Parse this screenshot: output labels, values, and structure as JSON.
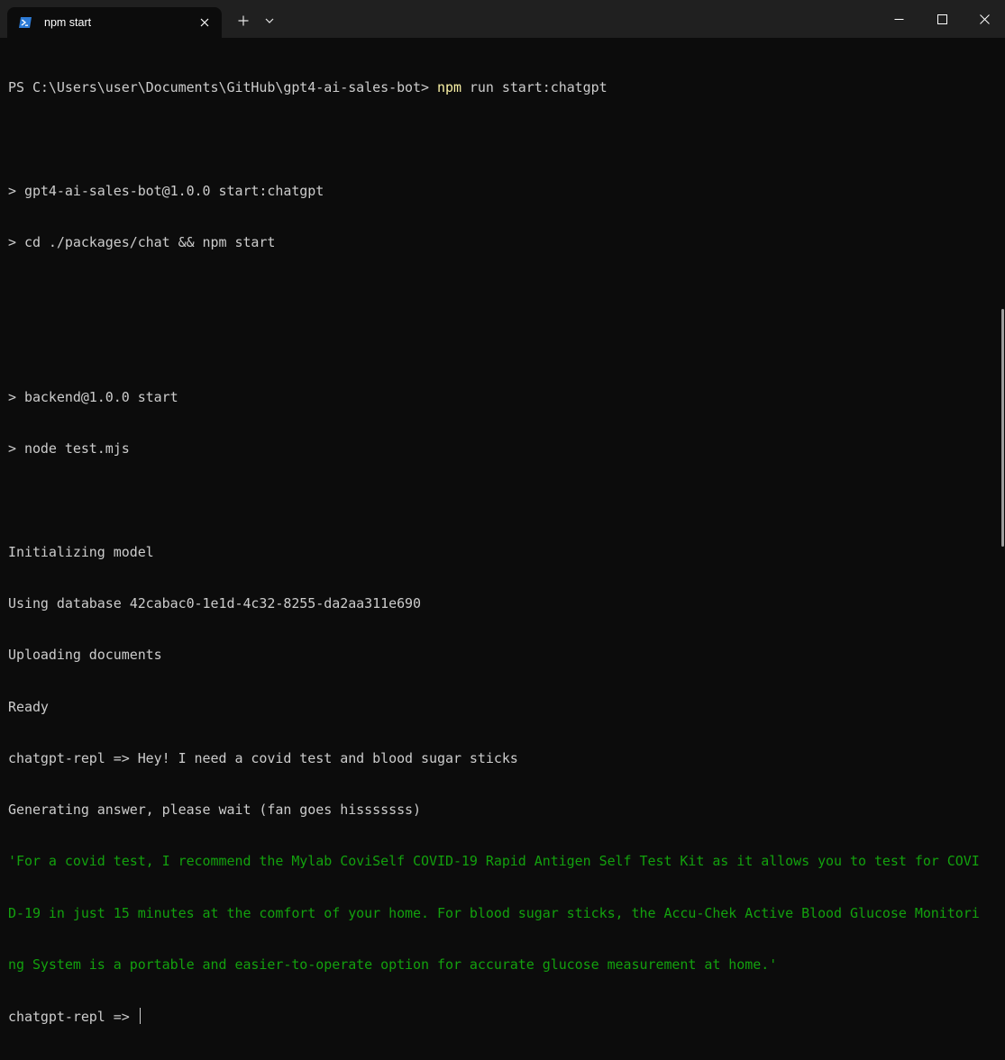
{
  "tab": {
    "title": "npm start",
    "icon": "powershell-icon"
  },
  "window_controls": {
    "minimize": "minimize-icon",
    "maximize": "maximize-icon",
    "close": "close-icon"
  },
  "colors": {
    "background": "#0c0c0c",
    "titlebar": "#202020",
    "text": "#cccccc",
    "command_highlight": "#f9f1a5",
    "answer": "#13a10e"
  },
  "terminal": {
    "prompt": "PS C:\\Users\\user\\Documents\\GitHub\\gpt4-ai-sales-bot> ",
    "command_exe": "npm",
    "command_args": " run start:chatgpt",
    "lines_a": [
      "",
      "> gpt4-ai-sales-bot@1.0.0 start:chatgpt",
      "> cd ./packages/chat && npm start",
      "",
      "",
      "> backend@1.0.0 start",
      "> node test.mjs",
      "",
      "Initializing model",
      "Using database 42cabac0-1e1d-4c32-8255-da2aa311e690",
      "Uploading documents",
      "Ready",
      "chatgpt-repl => Hey! I need a covid test and blood sugar sticks",
      "Generating answer, please wait (fan goes hisssssss)"
    ],
    "answer_lines": [
      "'For a covid test, I recommend the Mylab CoviSelf COVID-19 Rapid Antigen Self Test Kit as it allows you to test for COVI",
      "D-19 in just 15 minutes at the comfort of your home. For blood sugar sticks, the Accu-Chek Active Blood Glucose Monitori",
      "ng System is a portable and easier-to-operate option for accurate glucose measurement at home.'"
    ],
    "final_prompt": "chatgpt-repl => "
  }
}
